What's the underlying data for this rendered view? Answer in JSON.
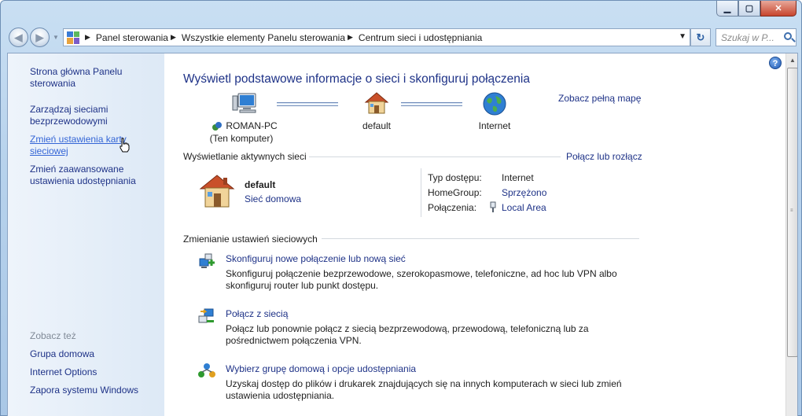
{
  "window": {
    "minimize_icon": "minimize-icon",
    "maximize_icon": "maximize-icon",
    "close_icon": "close-icon"
  },
  "addressbar": {
    "crumbs": [
      "Panel sterowania",
      "Wszystkie elementy Panelu sterowania",
      "Centrum sieci i udostępniania"
    ],
    "search_placeholder": "Szukaj w P..."
  },
  "sidebar": {
    "links": [
      {
        "label": "Strona główna Panelu sterowania"
      },
      {
        "label": "Zarządzaj sieciami bezprzewodowymi"
      },
      {
        "label": "Zmień ustawienia karty sieciowej"
      },
      {
        "label": "Zmień zaawansowane ustawienia udostępniania"
      }
    ],
    "see_also_heading": "Zobacz też",
    "see_also": [
      {
        "label": "Grupa domowa"
      },
      {
        "label": "Internet Options"
      },
      {
        "label": "Zapora systemu Windows"
      }
    ]
  },
  "main": {
    "title": "Wyświetl podstawowe informacje o sieci i skonfiguruj połączenia",
    "full_map_link": "Zobacz pełną mapę",
    "map_nodes": [
      {
        "label": "ROMAN-PC",
        "sublabel": "(Ten komputer)",
        "icon": "computer-icon"
      },
      {
        "label": "default",
        "icon": "house-icon"
      },
      {
        "label": "Internet",
        "icon": "globe-icon"
      }
    ],
    "active_networks": {
      "heading": "Wyświetlanie aktywnych sieci",
      "connect_link": "Połącz lub rozłącz",
      "network_name": "default",
      "network_type": "Sieć domowa",
      "props": [
        {
          "label": "Typ dostępu:",
          "value": "Internet"
        },
        {
          "label": "HomeGroup:",
          "value": "Sprzężono"
        },
        {
          "label": "Połączenia:",
          "value": "Local Area"
        }
      ]
    },
    "change_settings": {
      "heading": "Zmienianie ustawień sieciowych",
      "tasks": [
        {
          "link": "Skonfiguruj nowe połączenie lub nową sieć",
          "desc": "Skonfiguruj połączenie bezprzewodowe, szerokopasmowe, telefoniczne, ad hoc lub VPN albo skonfiguruj router lub punkt dostępu."
        },
        {
          "link": "Połącz z siecią",
          "desc": "Połącz lub ponownie połącz z siecią bezprzewodową, przewodową, telefoniczną lub za pośrednictwem połączenia VPN."
        },
        {
          "link": "Wybierz grupę domową i opcje udostępniania",
          "desc": "Uzyskaj dostęp do plików i drukarek znajdujących się na innych komputerach w sieci lub zmień ustawienia udostępniania."
        }
      ]
    }
  },
  "colors": {
    "link": "#1e3287",
    "link_hover": "#3365d6",
    "sidebar_bg": "#dde9f6"
  }
}
